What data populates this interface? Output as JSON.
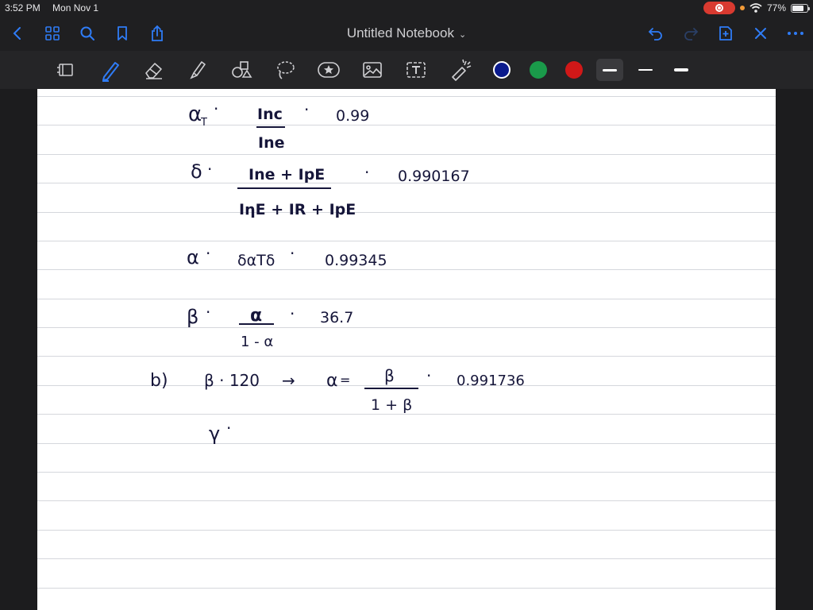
{
  "status": {
    "time": "3:52 PM",
    "date": "Mon Nov 1",
    "battery": "77%",
    "battery_level": 0.77
  },
  "nav": {
    "title": "Untitled Notebook",
    "icons": [
      "chevron-left-icon",
      "thumbnails-grid-icon",
      "search-icon",
      "bookmark-icon",
      "share-icon",
      "undo-icon",
      "redo-icon",
      "add-page-icon",
      "close-icon",
      "more-icon"
    ]
  },
  "toolbar": {
    "tools": [
      "page-layout-icon",
      "pen-icon",
      "eraser-icon",
      "highlighter-icon",
      "shapes-icon",
      "lasso-icon",
      "sticker-icon",
      "image-icon",
      "text-box-icon",
      "laser-pointer-icon"
    ],
    "colors": [
      "#0a1a8c",
      "#1a9a4a",
      "#d01818"
    ],
    "selected_tool": "pen-icon",
    "selected_color": "#0a1a8c",
    "selected_stroke": "thin"
  },
  "notes": {
    "l1_var": "α",
    "l1_sub": "T",
    "l1_num": "Inc",
    "l1_den": "Ine",
    "l1_val": "0.99",
    "l2_var": "δ",
    "l2_num": "Ine + IpE",
    "l2_den": "IηE + IR + IpE",
    "l2_val": "0.990167",
    "l3_var": "α",
    "l3_expr": "δαTδ",
    "l3_val": "0.99345",
    "l4_var": "β",
    "l4_num": "α",
    "l4_den": "1 - α",
    "l4_val": "36.7",
    "l5_part": "b)",
    "l5_lhs": "β · 120",
    "l5_arrow": "→",
    "l5_var": "α",
    "l5_num": "β",
    "l5_den": "1 + β",
    "l5_val": "0.991736",
    "l6_var": "γ"
  }
}
